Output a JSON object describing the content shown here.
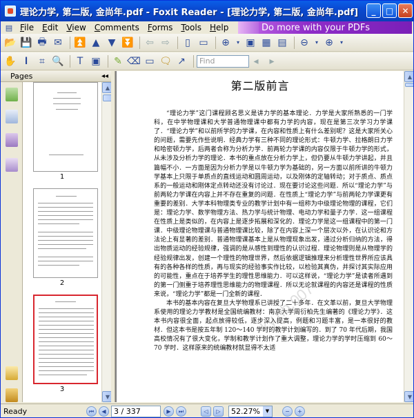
{
  "window": {
    "title": "理论力学, 第二版, 金尚年.pdf - Foxit Reader - [理论力学, 第二版, 金尚年.pdf]",
    "min_glyph": "_",
    "max_glyph": "□",
    "close_glyph": "✕"
  },
  "menu": [
    "File",
    "Edit",
    "View",
    "Comments",
    "Forms",
    "Tools",
    "Help"
  ],
  "promo": {
    "text": "Do more with your PDFs"
  },
  "toolbar": {
    "find_placeholder": "Find"
  },
  "panel": {
    "title": "Pages",
    "close_glyph": "◂◂"
  },
  "thumbnails": [
    {
      "number": "1"
    },
    {
      "number": "2"
    },
    {
      "number": "3"
    }
  ],
  "document": {
    "heading": "第二版前言",
    "paragraphs": [
      "“理论力学”这门课程顾名思义是讲力学的基本理论．力学是大家所熟悉的一门学科，在中学物理课和大学普通物理课中都有力学的内容，现在是第三次学习力学课了．“理论力学”和以前所学的力学课，在内容和性质上有什么差别呢？这是大家所关心的问题，需要先作些说明．经典力学有三种不同的理论形式：牛顿力学、拉格朗日力学和哈密顿力学，后两者合称为分析力学．前两轮力学课的内容仅限于牛顿力学的形式，从未涉及分析力学的理论．本书的重点放在分析力学上，但仍要从牛顿力学讲起，并且篇幅不小．一方面是因为分析力学是以牛顿力学为基础的，另一方面以前所讲的牛顿力学基本上只限于单质点的直线运动和圆周运动，以及刚体的定轴转动；对于质点、质点系的一般运动和刚体定点转动还没有讨论过．现在要讨论这些问题．所以“理论力学”与前两轮力学课在内容上并不存在重复的问题．在性质上“理论力学”与前两轮力学课更有重要的差别．大学本科物理类专业的教学计划中有一组称为中级理论物理的课程，它们是：理论力学、数学物理方法、热力学与统计物理、电动力学和量子力学．这一组课程在性质上是类似的，在内容上是逐步拓展和深化的．理论力学是这一组课程中的第一门课．中级理论物理课与普通物理课比较，除了在内容上深一个层次以外，在认识论和方法论上有显著的差别．普通物理课基本上是从物理现象出发，通过分析归纳的方法，得出物质运动的经验规律，强调的是从感性到理性的认识过程．理论物理则是从物理学的经验规律出发，创建一个理性的物理世界，然后依据逻辑推理来分析理性世界所应该具有的各种各样的性质，再与现实的经验事实作比较，以检验其真伪，并探讨其实际应用的可能性，重点在于培养学生的理性思维能力．可以这样说，“理论力学”是读者所遇到的第一门侧重于培养理性思维能力的物理课程．所以无论就课程的内容还是课程的性质来说，“理论力学”都是一门全新的课程．",
      "本书的基本内容在复旦大学物理系已讲授了二十多年．在文革以前，复旦大学物理系使用的理论力学教材是全国统编教材：南京大学周衍柏先生编著的《理论力学》．这本书内容很全面，起点放得较低，逐步深入提高，例题和习题丰富，是一本很好的教材．但这本书是按五年制 120～140 学时的教学计划编写的．到了 70 年代后期，我国高校情况有了很大变化，学制和教学计划作了重大调整，理论力学的学时压缩到 60～70 学时．这样原来的统编教材就显得不太适"
    ]
  },
  "watermark": "ky.hb.007",
  "status": {
    "ready": "Ready",
    "page_current": "3",
    "page_total": "337",
    "page_display": "3 / 337",
    "zoom": "52.27%"
  }
}
